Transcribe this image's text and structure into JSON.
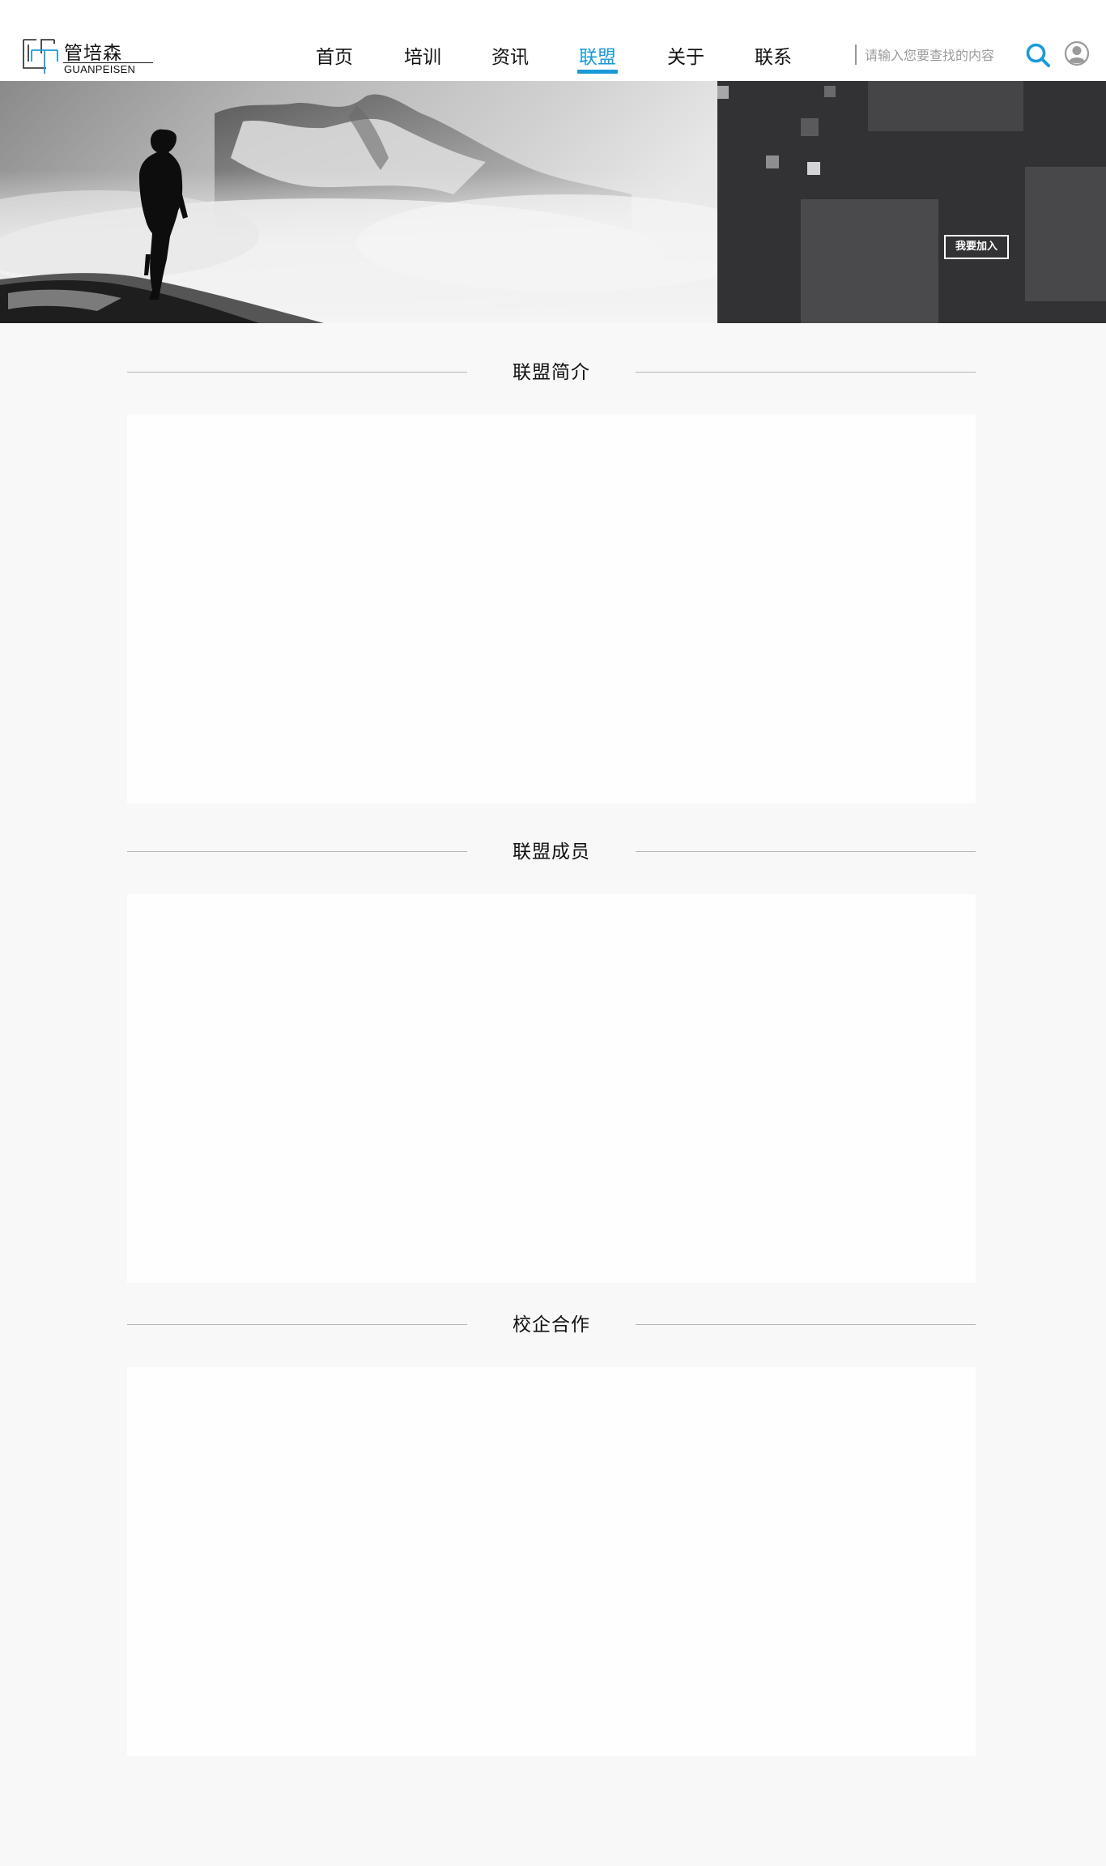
{
  "logo": {
    "cn": "管培森",
    "en": "GUANPEISEN",
    "accent": "#1a9ad6"
  },
  "nav": {
    "items": [
      {
        "label": "首页",
        "active": false
      },
      {
        "label": "培训",
        "active": false
      },
      {
        "label": "资讯",
        "active": false
      },
      {
        "label": "联盟",
        "active": true
      },
      {
        "label": "关于",
        "active": false
      },
      {
        "label": "联系",
        "active": false
      }
    ],
    "active_color": "#1a9ad6"
  },
  "search": {
    "placeholder": "请输入您要查找的内容",
    "value": "",
    "icon": "search-icon"
  },
  "user": {
    "icon": "user-avatar-icon"
  },
  "banner": {
    "join_label": "我要加入",
    "dark_color": "#323234"
  },
  "sections": [
    {
      "title": "联盟简介"
    },
    {
      "title": "联盟成员"
    },
    {
      "title": "校企合作"
    }
  ]
}
